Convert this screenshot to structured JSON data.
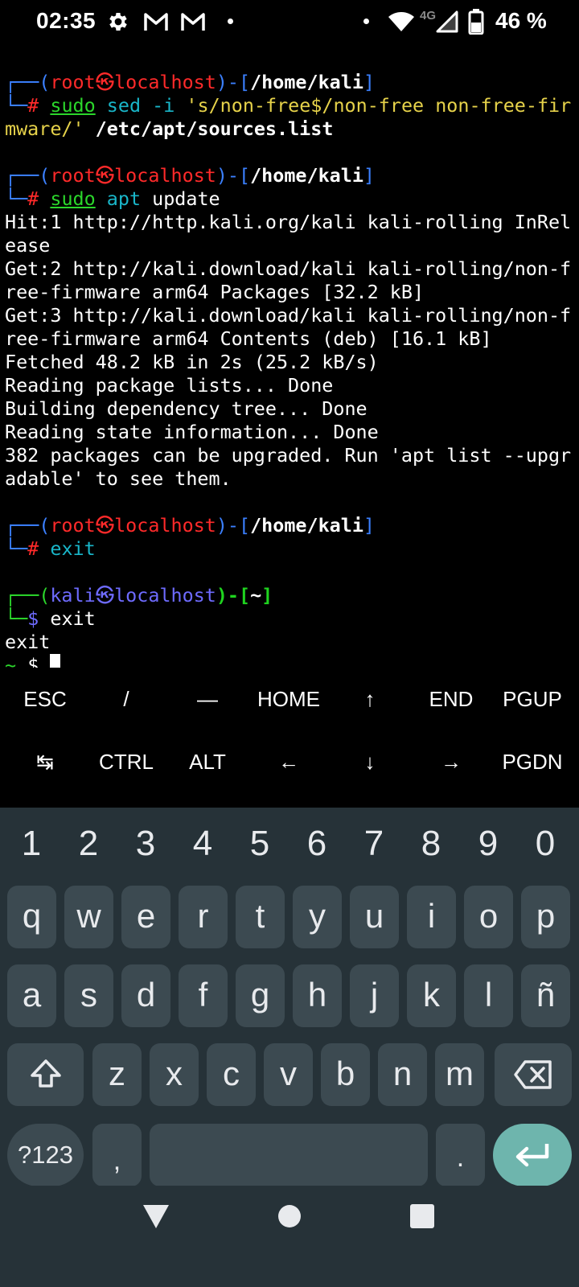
{
  "status_bar": {
    "time": "02:35",
    "icons": [
      "gear-icon",
      "gmail-icon",
      "gmail-icon",
      "dot-icon",
      "dot-icon",
      "wifi-icon",
      "cell-signal-icon",
      "battery-icon"
    ],
    "network_type": "4G",
    "battery": "46 %"
  },
  "terminal": {
    "block1": {
      "user": "root",
      "at": "㉿",
      "host": "localhost",
      "path": "/home/kali",
      "cmd_sudo": "sudo",
      "cmd_name": "sed",
      "cmd_flag": "-i",
      "cmd_string_part1": "'s/non-free$/non-free non-free-fir",
      "cmd_string_part2": "mware/'",
      "cmd_target": "/etc/apt/sources.list"
    },
    "block2": {
      "user": "root",
      "at": "㉿",
      "host": "localhost",
      "path": "/home/kali",
      "cmd_sudo": "sudo",
      "cmd_name": "apt",
      "cmd_arg": "update"
    },
    "output": [
      "Hit:1 http://http.kali.org/kali kali-rolling InRel",
      "ease",
      "Get:2 http://kali.download/kali kali-rolling/non-f",
      "ree-firmware arm64 Packages [32.2 kB]",
      "Get:3 http://kali.download/kali kali-rolling/non-f",
      "ree-firmware arm64 Contents (deb) [16.1 kB]",
      "Fetched 48.2 kB in 2s (25.2 kB/s)",
      "Reading package lists... Done",
      "Building dependency tree... Done",
      "Reading state information... Done",
      "382 packages can be upgraded. Run 'apt list --upgr",
      "adable' to see them."
    ],
    "block3": {
      "user": "root",
      "at": "㉿",
      "host": "localhost",
      "path": "/home/kali",
      "cmd": "exit"
    },
    "block4": {
      "user": "kali",
      "at": "㉿",
      "host": "localhost",
      "path": "~",
      "cmd": "exit"
    },
    "exit_echo": "exit",
    "final_prompt_tilde": "~",
    "final_prompt_dollar": "$"
  },
  "extra_keys": {
    "row1": [
      "ESC",
      "/",
      "—",
      "HOME",
      "↑",
      "END",
      "PGUP"
    ],
    "row2": [
      "↹",
      "CTRL",
      "ALT",
      "←",
      "↓",
      "→",
      "PGDN"
    ]
  },
  "keyboard": {
    "numbers": [
      "1",
      "2",
      "3",
      "4",
      "5",
      "6",
      "7",
      "8",
      "9",
      "0"
    ],
    "row1": [
      "q",
      "w",
      "e",
      "r",
      "t",
      "y",
      "u",
      "i",
      "o",
      "p"
    ],
    "row2": [
      "a",
      "s",
      "d",
      "f",
      "g",
      "h",
      "j",
      "k",
      "l",
      "ñ"
    ],
    "row3": [
      "z",
      "x",
      "c",
      "v",
      "b",
      "n",
      "m"
    ],
    "symbols_key": "?123",
    "comma_key": ",",
    "period_key": ".",
    "enter_color": "#6eb5ad"
  },
  "nav_bar": {
    "back": "back-icon",
    "home": "home-icon",
    "recents": "recents-icon"
  }
}
